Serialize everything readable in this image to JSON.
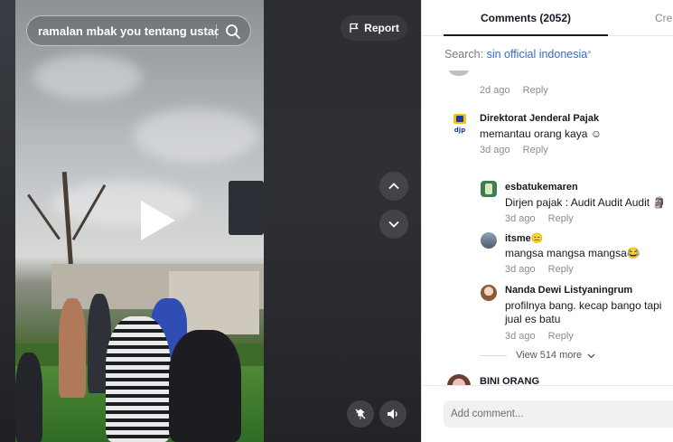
{
  "video": {
    "search_query": "ramalan mbak you tentang ustad...",
    "report_label": "Report"
  },
  "tabs": {
    "comments_label": "Comments (2052)",
    "creator_label": "Crea"
  },
  "search_banner": {
    "prefix": "Search: ",
    "keyword": "sin official indonesia"
  },
  "comments": [
    {
      "time": "2d ago",
      "reply": "Reply"
    },
    {
      "user": "Direktorat Jenderal Pajak",
      "avatar": "djp",
      "text": "memantau orang kaya ☺",
      "time": "3d ago",
      "reply": "Reply"
    }
  ],
  "replies": [
    {
      "user": "esbatukemaren",
      "text": "Dirjen pajak : Audit Audit Audit 🗿",
      "time": "3d ago",
      "reply": "Reply"
    },
    {
      "user": "itsme😑",
      "text": "mangsa mangsa mangsa😂",
      "time": "3d ago",
      "reply": "Reply"
    },
    {
      "user": "Nanda Dewi Listyaningrum",
      "text_line1": "profilnya bang. kecap bango tapi",
      "text_line2": "jual es batu",
      "time": "3d ago",
      "reply": "Reply"
    }
  ],
  "view_more": "View 514 more",
  "next_comment_user": "BINI ORANG",
  "add_comment_placeholder": "Add comment..."
}
